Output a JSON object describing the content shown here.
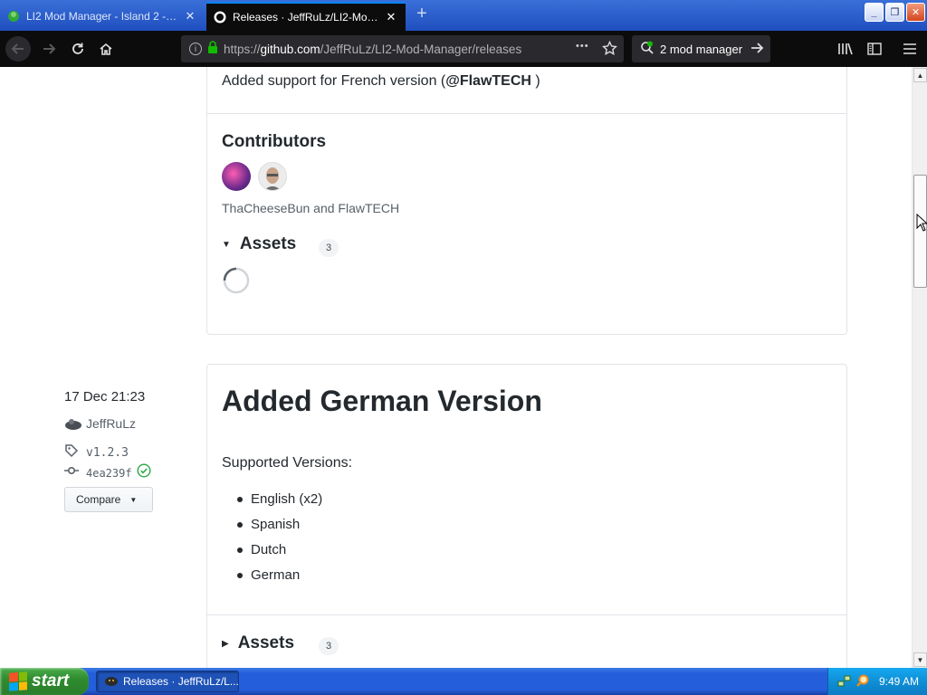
{
  "browser": {
    "tabs": [
      {
        "title": "LI2 Mod Manager - Island 2 - Ro",
        "active": false
      },
      {
        "title": "Releases · JeffRuLz/LI2-Mod-Man",
        "active": true
      }
    ],
    "url_prefix": "https://",
    "url_domain": "github.com",
    "url_path": "/JeffRuLz/LI2-Mod-Manager/releases",
    "url_more": "•••",
    "search_text": "2 mod manager"
  },
  "release_top": {
    "note": "Added support for French version (",
    "note_mention": "@FlawTECH",
    "note_end": " )",
    "contributors_heading": "Contributors",
    "contributors_names": "ThaCheeseBun and FlawTECH",
    "assets_label": "Assets",
    "assets_count": "3"
  },
  "release_main": {
    "date": "17 Dec 21:23",
    "author": "JeffRuLz",
    "tag": "v1.2.3",
    "commit": "4ea239f",
    "compare_label": "Compare",
    "title": "Added German Version",
    "supported_label": "Supported Versions:",
    "versions": [
      "English (x2)",
      "Spanish",
      "Dutch",
      "German"
    ],
    "assets_label": "Assets",
    "assets_count": "3"
  },
  "taskbar": {
    "start_label": "start",
    "task_label": "Releases · JeffRuLz/L...",
    "clock": "9:49 AM"
  },
  "colors": {
    "link_gray": "#586069",
    "verified_green": "#28a745",
    "text_dark": "#24292e"
  }
}
